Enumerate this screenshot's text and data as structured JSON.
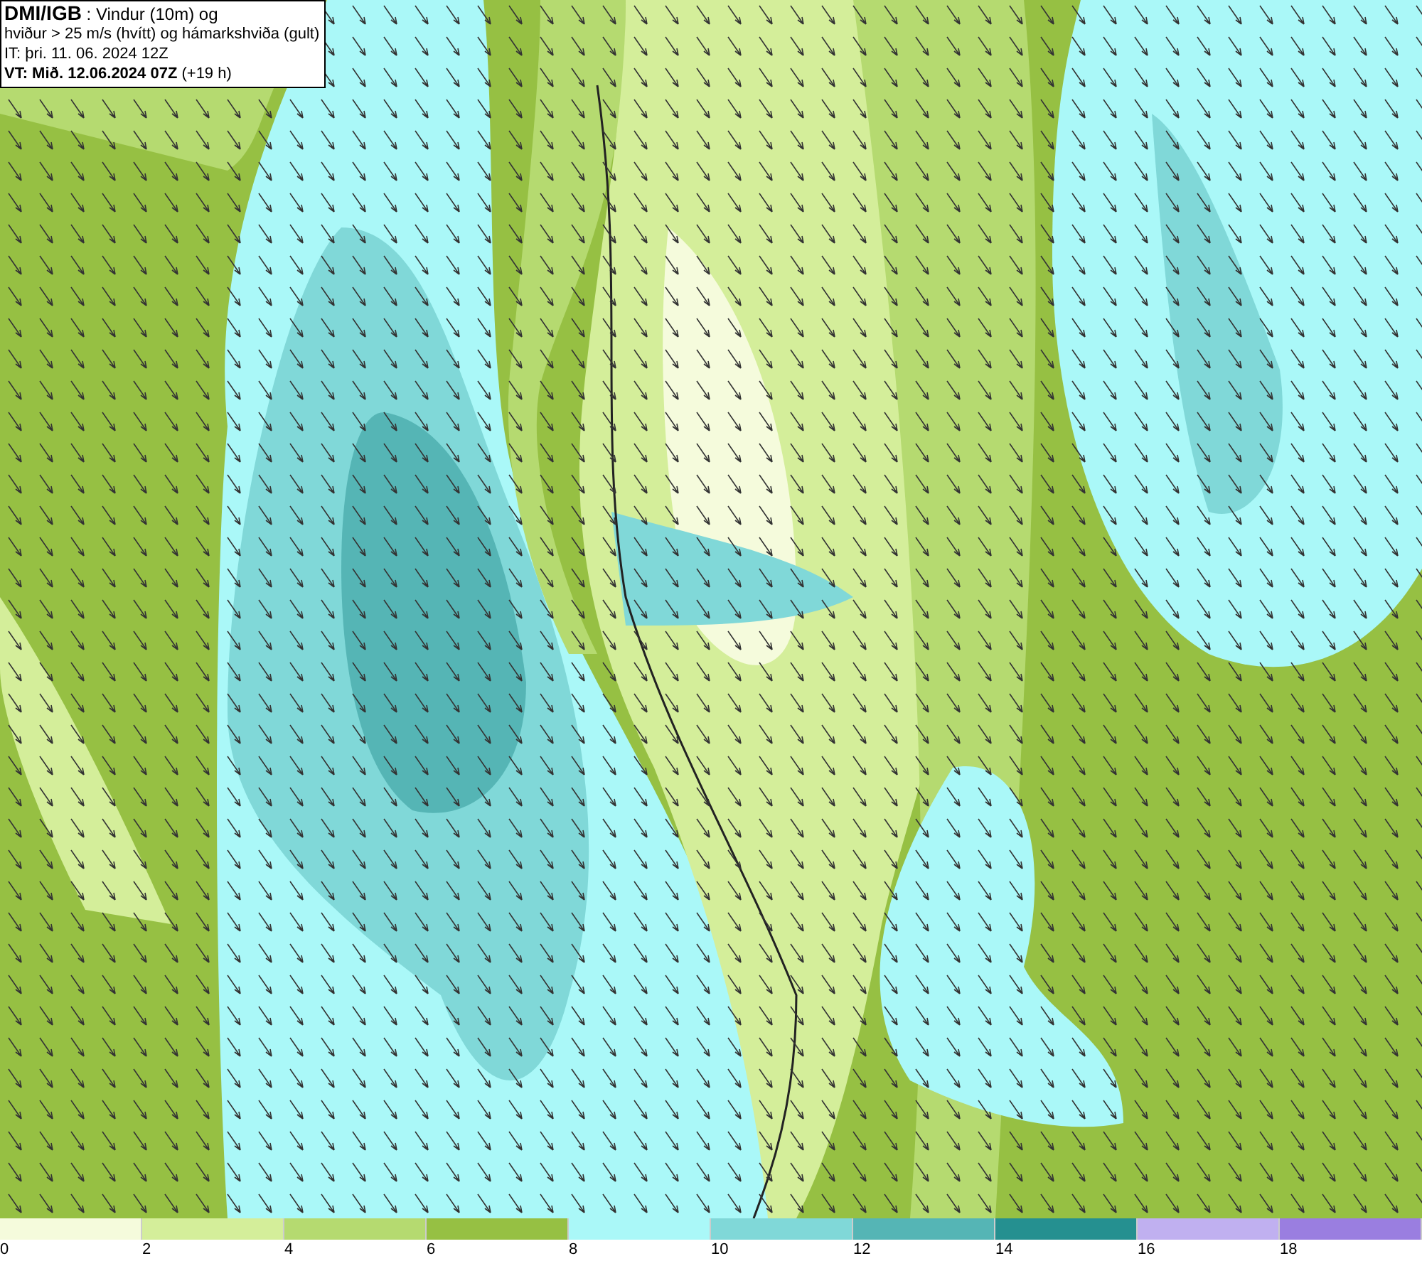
{
  "header": {
    "lines": [
      "**DMI/IGB** : Vindur (10m) og",
      "hviður > 25 m/s (hvítt) og hámarkshviða (gult)",
      "IT: þri. 11. 06. 2024 12Z",
      "**VT: Mið. 12.06.2024 07Z** (+19 h)"
    ]
  },
  "legend": {
    "bins": [
      {
        "label": "0",
        "color": "#f5fbdc"
      },
      {
        "label": "2",
        "color": "#d4ee9a"
      },
      {
        "label": "4",
        "color": "#b5da70"
      },
      {
        "label": "6",
        "color": "#96c043"
      },
      {
        "label": "8",
        "color": "#aaf8f8"
      },
      {
        "label": "10",
        "color": "#80d8d8"
      },
      {
        "label": "12",
        "color": "#55b5b5"
      },
      {
        "label": "14",
        "color": "#259090"
      },
      {
        "label": "16",
        "color": "#c0b0f0"
      },
      {
        "label": "18",
        "color": "#9a7ee0"
      }
    ]
  }
}
